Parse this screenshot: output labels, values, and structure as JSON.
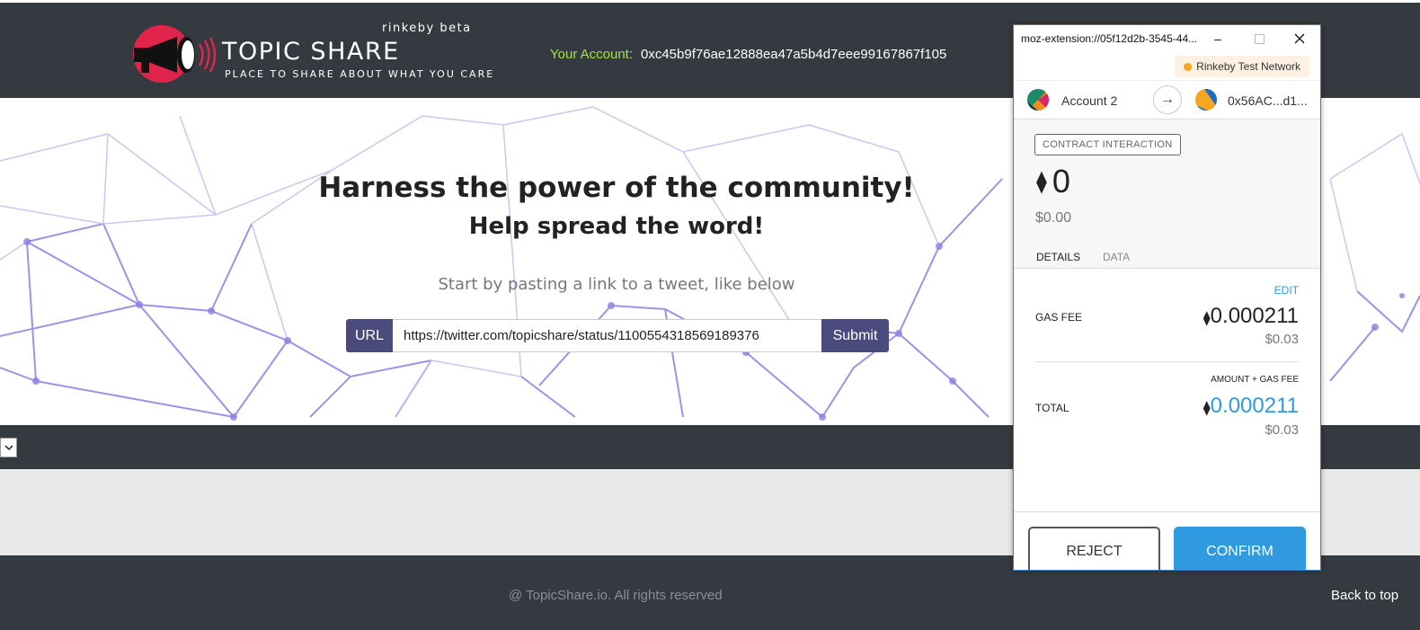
{
  "site": {
    "logo_title": "TOPIC SHARE",
    "logo_beta": "rinkeby beta",
    "logo_tagline": "PLACE TO SHARE ABOUT WHAT YOU CARE",
    "logo_icon": "megaphone-icon",
    "brand_color": "#e0244b",
    "account_label": "Your Account:",
    "account_value": "0xc45b9f76ae12888ea47a5b4d7eee99167867f105"
  },
  "hero": {
    "title": "Harness the power of the community!",
    "subtitle": "Help spread the word!",
    "prompt": "Start by pasting a link to a tweet, like below",
    "url_label": "URL",
    "url_value": "https://twitter.com/topicshare/status/1100554318569189376",
    "submit_label": "Submit",
    "accent_color": "#4b4a7c"
  },
  "select_stub": {
    "icon": "chevron-down-icon"
  },
  "footer": {
    "copyright": "@ TopicShare.io. All rights reserved",
    "back_to_top": "Back to top"
  },
  "popup": {
    "window_title": "moz-extension://05f12d2b-3545-44...",
    "network": "Rinkeby Test Network",
    "from_account": "Account 2",
    "to_account": "0x56AC...d1...",
    "badge": "CONTRACT INTERACTION",
    "amount": "0",
    "amount_usd": "$0.00",
    "tabs": [
      "DETAILS",
      "DATA"
    ],
    "edit": "EDIT",
    "gas_fee_label": "GAS FEE",
    "gas_fee_value": "0.000211",
    "gas_fee_usd": "$0.03",
    "amount_gas_label": "AMOUNT + GAS FEE",
    "total_label": "TOTAL",
    "total_value": "0.000211",
    "total_usd": "$0.03",
    "reject_label": "REJECT",
    "confirm_label": "CONFIRM",
    "confirm_color": "#2f9ae0"
  }
}
